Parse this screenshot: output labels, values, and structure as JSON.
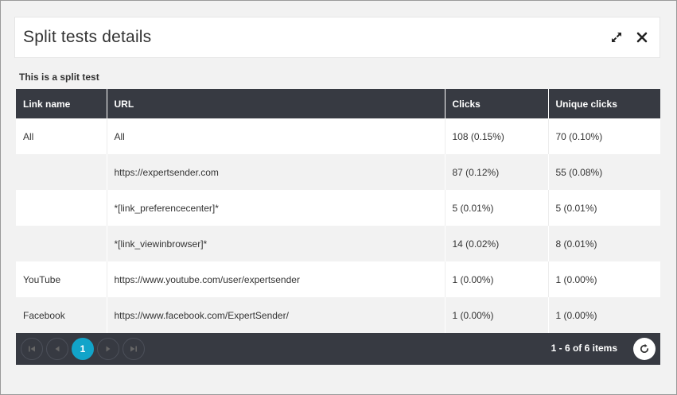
{
  "dialog": {
    "title": "Split tests details",
    "subtitle": "This is a split test",
    "expand_icon": "expand-icon",
    "close_icon": "close-icon"
  },
  "table": {
    "columns": [
      "Link name",
      "URL",
      "Clicks",
      "Unique clicks"
    ],
    "rows": [
      {
        "link_name": "All",
        "url": "All",
        "clicks": "108 (0.15%)",
        "unique_clicks": "70 (0.10%)"
      },
      {
        "link_name": "",
        "url": "https://expertsender.com",
        "clicks": "87 (0.12%)",
        "unique_clicks": "55 (0.08%)"
      },
      {
        "link_name": "",
        "url": "*[link_preferencecenter]*",
        "clicks": "5 (0.01%)",
        "unique_clicks": "5 (0.01%)"
      },
      {
        "link_name": "",
        "url": "*[link_viewinbrowser]*",
        "clicks": "14 (0.02%)",
        "unique_clicks": "8 (0.01%)"
      },
      {
        "link_name": "YouTube",
        "url": "https://www.youtube.com/user/expertsender",
        "clicks": "1 (0.00%)",
        "unique_clicks": "1 (0.00%)"
      },
      {
        "link_name": "Facebook",
        "url": "https://www.facebook.com/ExpertSender/",
        "clicks": "1 (0.00%)",
        "unique_clicks": "1 (0.00%)"
      }
    ]
  },
  "pager": {
    "current_page": "1",
    "info": "1 - 6 of 6 items",
    "colors": {
      "bar": "#373a42",
      "current": "#12a4c9"
    }
  }
}
